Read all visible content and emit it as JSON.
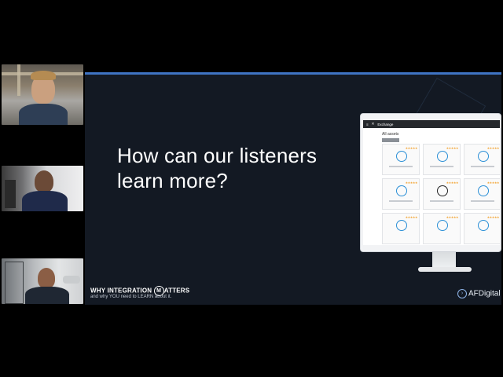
{
  "participants": [
    {
      "name": ""
    },
    {
      "name": ""
    },
    {
      "name": ""
    }
  ],
  "slide": {
    "title_line1": "How can our listeners",
    "title_line2": "learn more?",
    "footer_title_pre": "WHY INTEGRATION ",
    "footer_title_m": "M",
    "footer_title_post": "ATTERS",
    "footer_subtitle": "and why YOU need to LEARN about it.",
    "brand": "AFDigital",
    "accent_color": "#3f74c4",
    "background_color": "#131923"
  },
  "app_mockup": {
    "app_name": "Exchange",
    "section_label": "All assets",
    "cards": [
      {
        "stars": "★★★★★",
        "icon": "salesforce-icon"
      },
      {
        "stars": "★★★★★",
        "icon": "sap-icon"
      },
      {
        "stars": "★★★★★",
        "icon": "connector-icon"
      },
      {
        "stars": "★★★★★",
        "icon": "netsuite-icon"
      },
      {
        "stars": "★★★★★",
        "icon": "k-icon"
      },
      {
        "stars": "★★★★★",
        "icon": "connector-icon"
      },
      {
        "stars": "★★★★★",
        "icon": "connector-icon"
      },
      {
        "stars": "★★★★★",
        "icon": "connector-icon"
      },
      {
        "stars": "★★★★★",
        "icon": "connector-icon"
      }
    ]
  }
}
